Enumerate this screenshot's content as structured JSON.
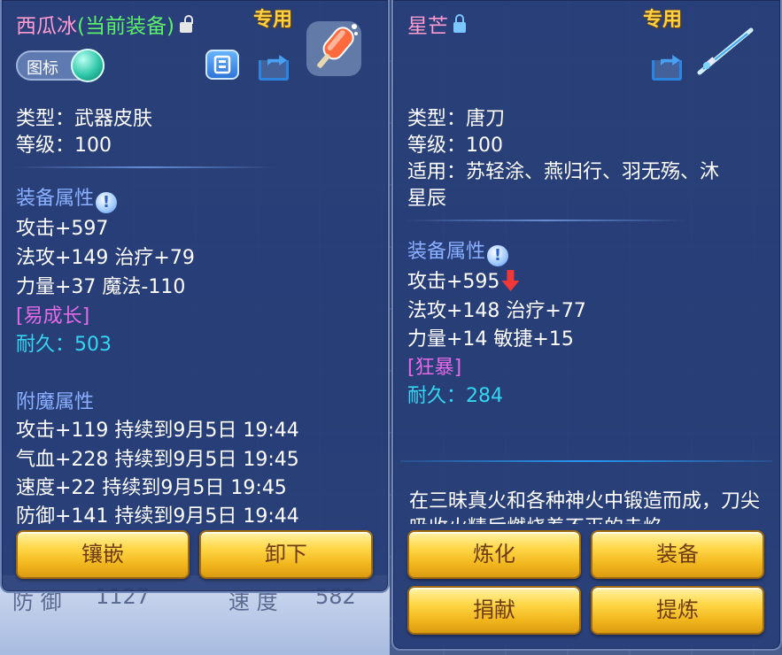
{
  "background": {
    "stat_defense": "防 御",
    "stat_defense_value": "1127",
    "stat_speed": "速 度",
    "stat_speed_value": "582"
  },
  "left": {
    "title_name": "西瓜冰",
    "title_status": "(当前装备)",
    "special": "专用",
    "toggle_label": "图标",
    "lines": {
      "type": "类型：武器皮肤",
      "level": "等级：100",
      "attr_header": "装备属性",
      "attack": "攻击+597",
      "magic_heal": "法攻+149 治疗+79",
      "str_mag": "力量+37 魔法-110",
      "growth": "[易成长]",
      "durability_label": "耐久：",
      "durability_value": "503",
      "enchant_header": "附魔属性",
      "enchant1": "攻击+119 持续到9月5日 19:44",
      "enchant2": "气血+228 持续到9月5日 19:45",
      "enchant3": "速度+22 持续到9月5日 19:45",
      "enchant4": "防御+141 持续到9月5日 19:44"
    },
    "buttons": {
      "inlay": "镶嵌",
      "unequip": "卸下"
    },
    "icons": [
      "lock-open-icon",
      "copy-icon",
      "share-icon",
      "popsicle-item-icon",
      "info-icon"
    ]
  },
  "right": {
    "title_name": "星芒",
    "special": "专用",
    "lines": {
      "type": "类型：唐刀",
      "level": "等级：100",
      "applies": "适用：苏轻涂、燕归行、羽无殇、沐",
      "applies2": "星辰",
      "attr_header": "装备属性",
      "attack": "攻击+595",
      "magic_heal": "法攻+148 治疗+77",
      "str_agi": "力量+14 敏捷+15",
      "trait": "[狂暴]",
      "durability_label": "耐久：",
      "durability_value": "284",
      "description": "在三昧真火和各种神火中锻造而成，刀尖吸收火精后燃烧着不灭的赤焰"
    },
    "buttons": {
      "refine": "炼化",
      "equip": "装备",
      "donate": "捐献",
      "extract": "提炼"
    },
    "icons": [
      "lock-closed-icon",
      "share-icon",
      "sword-item-icon",
      "info-icon",
      "down-arrow-icon"
    ]
  },
  "colors": {
    "panel": "#283e78",
    "pink_title": "#ff9bd0",
    "green_status": "#5cf06a",
    "section_blue": "#8ab0ff",
    "magenta": "#e46ae6",
    "cyan": "#35d6f0",
    "gold": "#ffd040",
    "button_text": "#6e3b12"
  }
}
